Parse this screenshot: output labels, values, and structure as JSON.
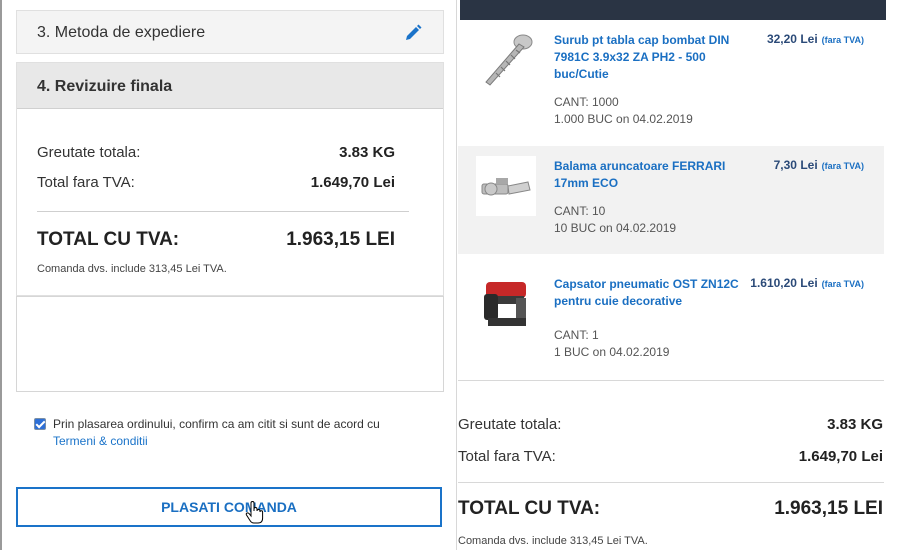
{
  "checkout": {
    "step3_title": "3. Metoda de expediere",
    "step4_title": "4. Revizuire finala",
    "summary": {
      "weight_label": "Greutate totala:",
      "weight_value": "3.83 KG",
      "net_label": "Total fara TVA:",
      "net_value": "1.649,70 Lei",
      "total_label": "TOTAL CU TVA:",
      "total_value": "1.963,15 LEI",
      "vat_note": "Comanda dvs. include 313,45 Lei TVA."
    },
    "comment_placeholder": "",
    "terms_text": "Prin plasarea ordinului, confirm ca am citit si sunt de acord cu",
    "terms_link": "Termeni & conditii",
    "terms_checked": true,
    "place_order_label": "PLASATI COMANDA"
  },
  "cart": {
    "items": [
      {
        "name": "Surub pt tabla cap bombat DIN 7981C 3.9x32 ZA PH2 - 500 buc/Cutie",
        "price": "32,20 Lei",
        "vat_note": "(fara TVA)",
        "qty": "CANT:  1000",
        "delivery": "1.000 BUC on 04.02.2019",
        "icon": "screw-image"
      },
      {
        "name": "Balama aruncatoare FERRARI 17mm ECO",
        "price": "7,30 Lei",
        "vat_note": "(fara TVA)",
        "qty": "CANT:  10",
        "delivery": "10 BUC on 04.02.2019",
        "icon": "hinge-image"
      },
      {
        "name": "Capsator pneumatic OST ZN12C pentru cuie decorative",
        "price": "1.610,20 Lei",
        "vat_note": "(fara TVA)",
        "qty": "CANT:  1",
        "delivery": "1 BUC on 04.02.2019",
        "icon": "nail-gun-image"
      }
    ],
    "summary": {
      "weight_label": "Greutate totala:",
      "weight_value": "3.83 KG",
      "net_label": "Total fara TVA:",
      "net_value": "1.649,70 Lei",
      "total_label": "TOTAL CU TVA:",
      "total_value": "1.963,15 LEI",
      "vat_note": "Comanda dvs. include 313,45 Lei TVA."
    }
  },
  "colors": {
    "link_blue": "#1a73c9",
    "price_navy": "#2b4a78",
    "header_dark": "#2a3444"
  }
}
